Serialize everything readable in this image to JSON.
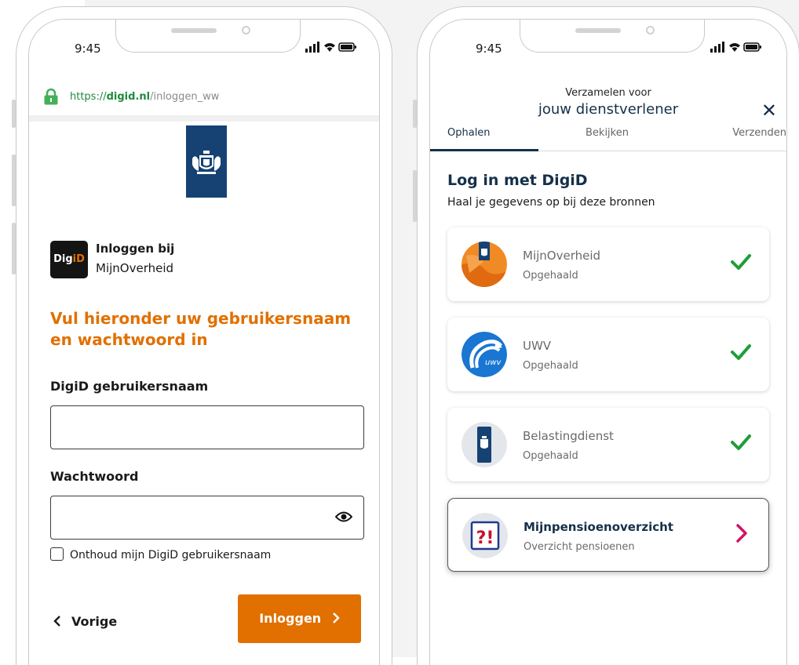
{
  "status_bar": {
    "time": "9:45"
  },
  "left_screen": {
    "url": {
      "scheme": "https://",
      "domain": "digid.nl",
      "path": "/inloggen_ww"
    },
    "brand": {
      "digid_part1": "Dig",
      "digid_part2": "iD",
      "login_to": "Inloggen bij",
      "service": "MijnOverheid"
    },
    "headline": "Vul hieronder uw gebruikersnaam en wachtwoord in",
    "username": {
      "label": "DigiD gebruikersnaam",
      "value": ""
    },
    "password": {
      "label": "Wachtwoord",
      "value": ""
    },
    "remember_label": "Onthoud mijn DigiD gebruikersnaam",
    "back_label": "Vorige",
    "login_label": "Inloggen"
  },
  "right_screen": {
    "subtitle": "Verzamelen voor",
    "title": "jouw dienstverlener",
    "tabs": [
      "Ophalen",
      "Bekijken",
      "Verzenden"
    ],
    "section_title": "Log in met DigiD",
    "section_subtitle": "Haal je gegevens op bij deze bronnen",
    "sources": [
      {
        "name": "MijnOverheid",
        "status": "Opgehaald"
      },
      {
        "name": "UWV",
        "status": "Opgehaald"
      },
      {
        "name": "Belastingdienst",
        "status": "Opgehaald"
      },
      {
        "name": "Mijnpensioenoverzicht",
        "status": "Overzicht pensioenen"
      }
    ],
    "uwv_logo_text": "uwv",
    "pension_logo_text": "?!"
  },
  "colors": {
    "digid_orange": "#e17000",
    "rijksoverheid_blue": "#154273",
    "navy_text": "#15304a",
    "check_green": "#1e9e3a",
    "chevron_pink": "#d41367",
    "url_green": "#1f8a3d"
  },
  "icons": {
    "lock": "lock-icon",
    "eye": "eye-icon",
    "back": "chevron-left-icon",
    "forward": "chevron-right-icon",
    "close": "close-icon",
    "check": "checkmark-icon",
    "signal": "signal-icon",
    "wifi": "wifi-icon",
    "battery": "battery-icon"
  }
}
